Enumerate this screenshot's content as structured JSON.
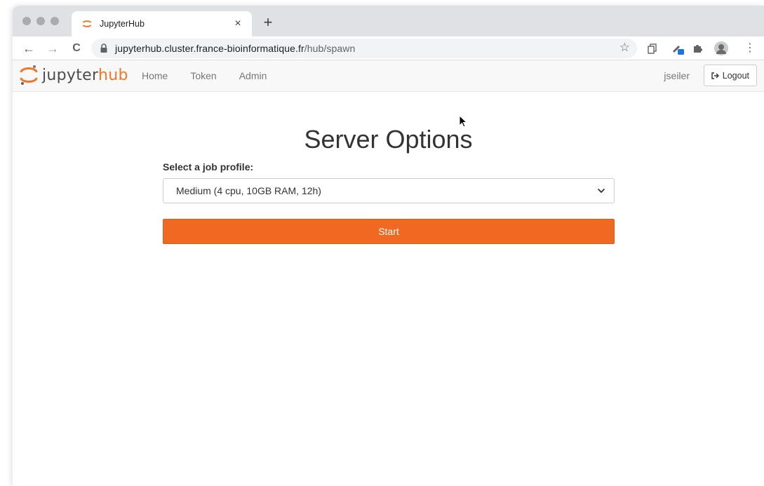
{
  "browser": {
    "tab_title": "JupyterHub",
    "tab_close": "×",
    "new_tab": "+",
    "url_host": "jupyterhub.cluster.france-bioinformatique.fr",
    "url_path": "/hub/spawn",
    "back": "←",
    "forward": "→",
    "reload": "C",
    "bookmark": "☆",
    "menu": "⋮"
  },
  "hub": {
    "logo_jupyter": "jupyter",
    "logo_hub": "hub",
    "nav": {
      "home": "Home",
      "token": "Token",
      "admin": "Admin"
    },
    "username": "jseiler",
    "logout_label": "Logout"
  },
  "page": {
    "title": "Server Options",
    "profile_label": "Select a job profile:",
    "profile_selected": "Medium (4 cpu, 10GB RAM, 12h)",
    "start_label": "Start"
  },
  "colors": {
    "accent": "#f06923",
    "logo_orange": "#f37626"
  }
}
